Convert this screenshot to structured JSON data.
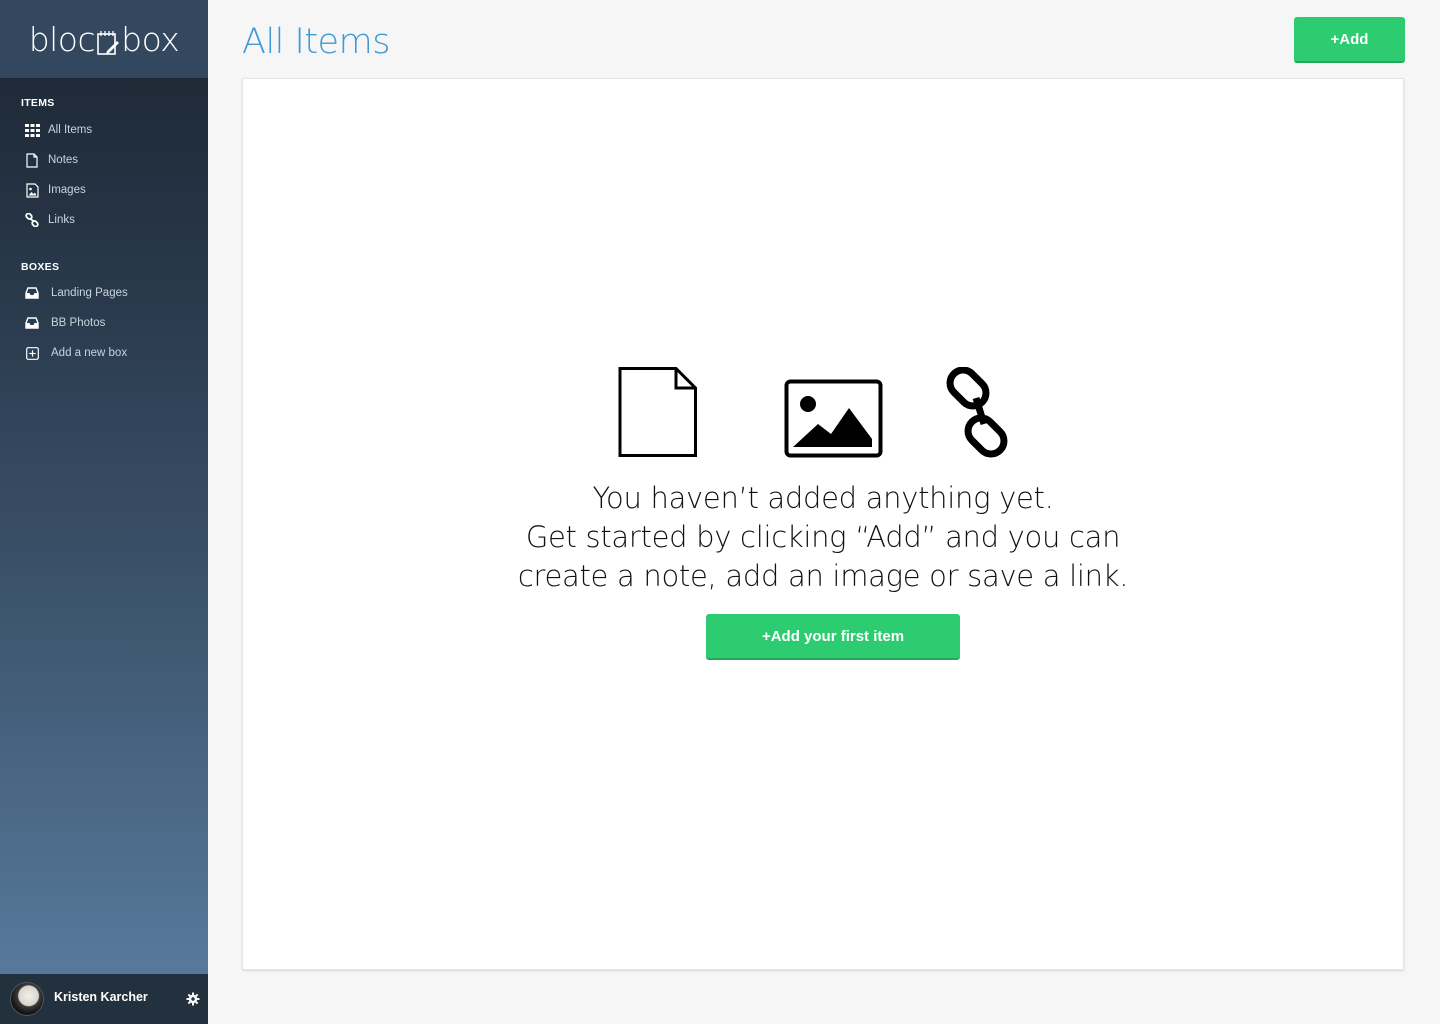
{
  "app": {
    "logo_text_left": "bloc",
    "logo_text_right": "box"
  },
  "sidebar": {
    "items_label": "ITEMS",
    "items": [
      {
        "label": "All Items",
        "icon": "grid-icon"
      },
      {
        "label": "Notes",
        "icon": "note-icon"
      },
      {
        "label": "Images",
        "icon": "image-icon"
      },
      {
        "label": "Links",
        "icon": "link-icon"
      }
    ],
    "boxes_label": "BOXES",
    "boxes": [
      {
        "label": "Landing Pages",
        "icon": "inbox-icon"
      },
      {
        "label": "BB Photos",
        "icon": "inbox-icon"
      },
      {
        "label": "Add a new box",
        "icon": "plus-square-icon"
      }
    ]
  },
  "user": {
    "name": "Kristen Karcher",
    "settings_icon": "gear-icon"
  },
  "header": {
    "title": "All Items",
    "add_button": "+Add"
  },
  "empty_state": {
    "line1": "You haven’t added anything yet.",
    "line2": "Get started by clicking “Add” and you can",
    "line3": "create a note, add an image or save a link.",
    "cta": "+Add your first item",
    "icons": [
      "note-icon",
      "image-icon",
      "link-icon"
    ]
  },
  "colors": {
    "accent_blue": "#3f9ad6",
    "button_green": "#2ecc71",
    "sidebar_top": "#1c2631",
    "sidebar_bottom": "#5a7ea1"
  }
}
